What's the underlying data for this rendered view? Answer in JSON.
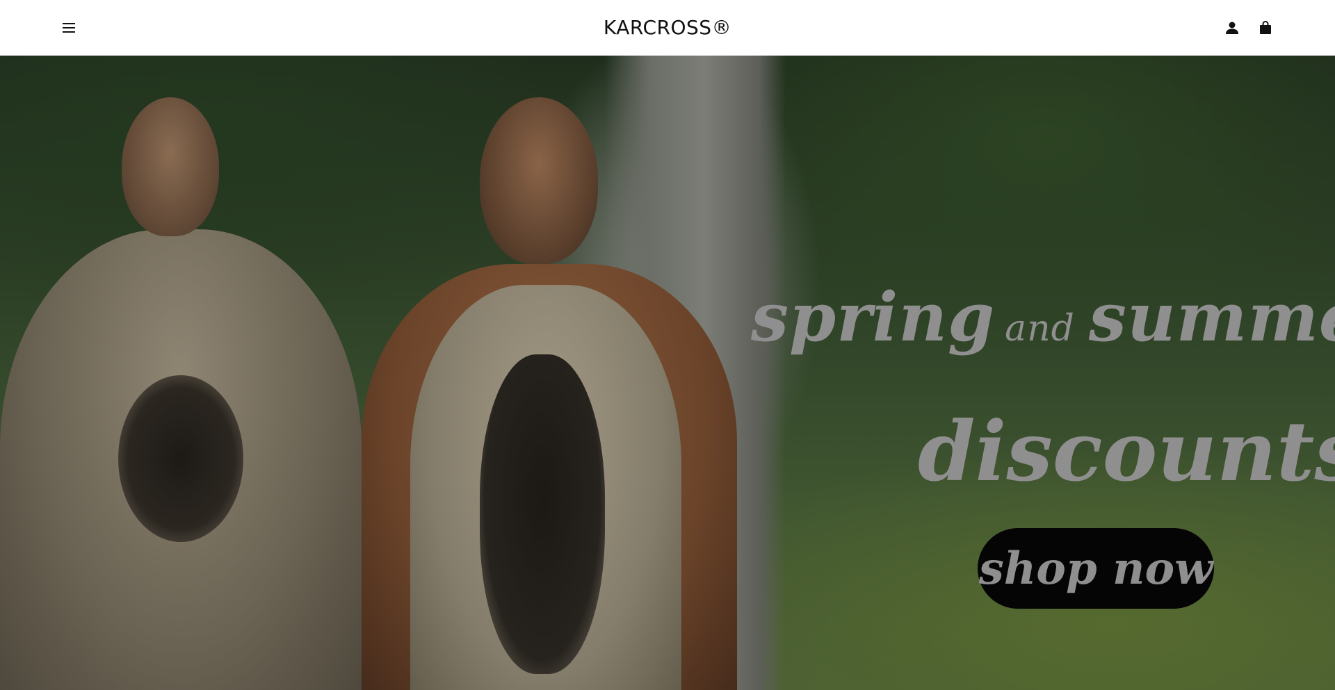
{
  "header": {
    "logo": "KARCROSS®",
    "menu_icon": "hamburger-menu-icon",
    "account_icon": "user-icon",
    "cart_icon": "shopping-bag-icon"
  },
  "hero": {
    "headline_word1": "spring",
    "headline_connector": "and",
    "headline_word2": "summer",
    "subheadline": "discounts",
    "cta_label": "shop now",
    "text_color": "#8f8f8f",
    "cta_background": "#050505"
  }
}
